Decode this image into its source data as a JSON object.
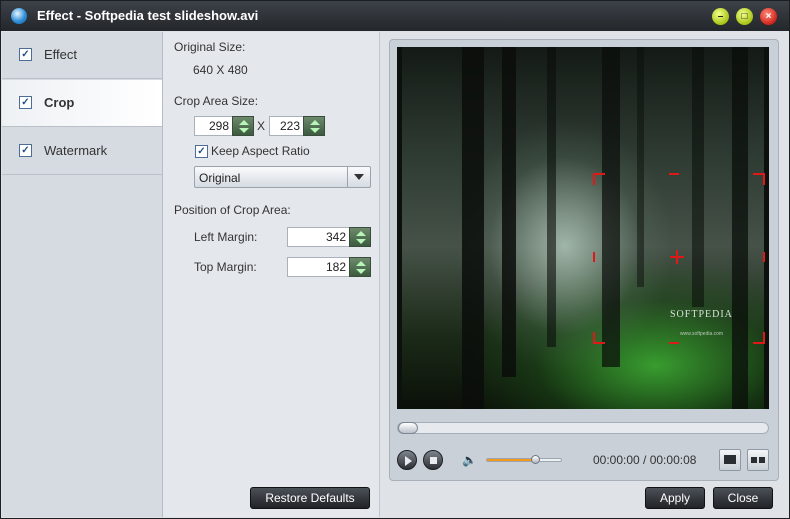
{
  "window": {
    "title": "Effect - Softpedia test slideshow.avi",
    "minimize_glyph": "–",
    "maximize_glyph": "□",
    "close_glyph": "×"
  },
  "sidebar": {
    "items": [
      {
        "label": "Effect",
        "checked": true,
        "active": false
      },
      {
        "label": "Crop",
        "checked": true,
        "active": true
      },
      {
        "label": "Watermark",
        "checked": true,
        "active": false
      }
    ],
    "check_glyph": "✓"
  },
  "crop": {
    "original_size_label": "Original Size:",
    "original_size_value": "640 X 480",
    "crop_area_size_label": "Crop Area Size:",
    "width": "298",
    "separator": "X",
    "height": "223",
    "keep_aspect_label": "Keep Aspect Ratio",
    "keep_aspect_checked": true,
    "aspect_option": "Original",
    "position_label": "Position of Crop Area:",
    "left_margin_label": "Left Margin:",
    "left_margin": "342",
    "top_margin_label": "Top Margin:",
    "top_margin": "182",
    "restore_label": "Restore Defaults"
  },
  "player": {
    "watermark_text": "SOFTPEDIA",
    "watermark_subtext": "www.softpedia.com",
    "time": "00:00:00 / 00:00:08",
    "volume_icon": "speaker-icon",
    "volume_level": 0.65,
    "seek_position": 0.0,
    "crop_color": "#e01818"
  },
  "footer": {
    "apply_label": "Apply",
    "close_label": "Close"
  }
}
